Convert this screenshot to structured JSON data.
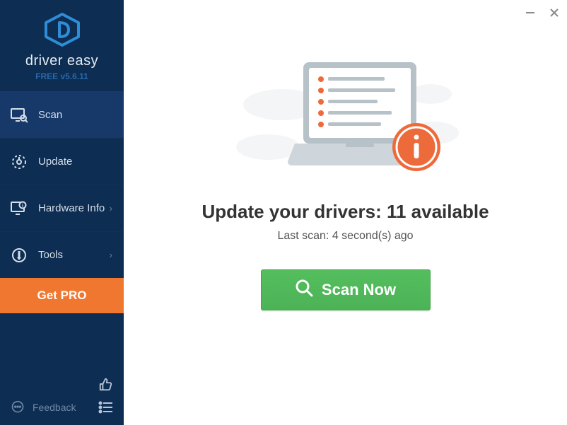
{
  "window": {
    "minimize_title": "Minimize",
    "close_title": "Close"
  },
  "brand": {
    "name": "driver easy",
    "version": "FREE v5.6.11"
  },
  "sidebar": {
    "items": [
      {
        "label": "Scan",
        "icon": "scan-monitor-icon",
        "active": true,
        "has_submenu": false
      },
      {
        "label": "Update",
        "icon": "update-gear-icon",
        "active": false,
        "has_submenu": false
      },
      {
        "label": "Hardware Info",
        "icon": "hardware-info-icon",
        "active": false,
        "has_submenu": true
      },
      {
        "label": "Tools",
        "icon": "tools-icon",
        "active": false,
        "has_submenu": true
      }
    ],
    "get_pro_label": "Get PRO",
    "feedback_label": "Feedback"
  },
  "main": {
    "headline": "Update your drivers: 11 available",
    "subline": "Last scan: 4 second(s) ago",
    "scan_button_label": "Scan Now"
  },
  "colors": {
    "sidebar_bg": "#0d2d52",
    "sidebar_active": "#16396a",
    "accent_orange": "#f07730",
    "scan_green": "#4cb356",
    "info_orange": "#ed6a3b"
  }
}
